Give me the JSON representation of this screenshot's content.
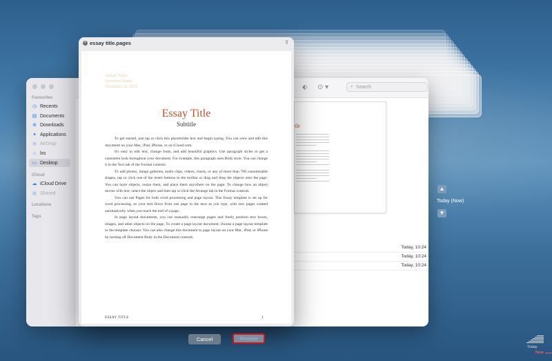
{
  "window_title": "essay title.pages",
  "document": {
    "author_lines": [
      "Author Name",
      "Instructor Name",
      "December 20, 2023"
    ],
    "title": "Essay Title",
    "subtitle": "Subtitle",
    "paragraphs": [
      "To get started, just tap or click this placeholder text and begin typing. You can view and edit this document on your Mac, iPad, iPhone, or on iCloud.com.",
      "It's easy to edit text, change fonts, and add beautiful graphics. Use paragraph styles to get a consistent look throughout your document. For example, this paragraph uses Body style. You can change it in the Text tab of the Format controls.",
      "To add photos, image galleries, audio clips, videos, charts, or any of more than 700 customisable shapes, tap or click one of the insert buttons in the toolbar or drag and drop the objects onto the page. You can layer objects, resize them, and place them anywhere on the page. To change how an object moves with text, select the object and then tap or click the Arrange tab in the Format controls.",
      "You can use Pages for both word processing and page layout. This Essay template is set up for word processing, so your text flows from one page to the next as you type, with new pages created automatically when you reach the end of a page.",
      "In page layout documents, you can manually rearrange pages and freely position text boxes, images, and other objects on the page. To create a page layout document, choose a page layout template in the template chooser. You can also change this document to page layout on your Mac, iPad, or iPhone by turning off Document Body in the Document controls."
    ],
    "footer_left": "ESSAY TITLE",
    "footer_right": "1"
  },
  "finder": {
    "sidebar": {
      "favourites_label": "Favourites",
      "icloud_label": "iCloud",
      "locations_label": "Locations",
      "tags_label": "Tags",
      "favourites": [
        {
          "label": "Recents",
          "icon": "clock-icon"
        },
        {
          "label": "Documents",
          "icon": "doc-icon"
        },
        {
          "label": "Downloads",
          "icon": "download-icon"
        },
        {
          "label": "Applications",
          "icon": "apps-icon"
        },
        {
          "label": "AirDrop",
          "icon": "airdrop-icon"
        },
        {
          "label": "lxs",
          "icon": "home-icon"
        },
        {
          "label": "Desktop",
          "icon": "desktop-icon"
        }
      ],
      "icloud": [
        {
          "label": "iCloud Drive",
          "icon": "cloud-icon"
        },
        {
          "label": "Shared",
          "icon": "shared-icon"
        }
      ]
    },
    "search_placeholder": "Search",
    "preview_title": "tle",
    "file_dates": [
      "Today, 10:24",
      "Today, 10:24",
      "Today, 10:24"
    ]
  },
  "buttons": {
    "cancel": "Cancel",
    "restore": "Restore"
  },
  "timeline": {
    "current": "Today (Now)",
    "today": "Today",
    "now": "Now"
  },
  "colors": {
    "title_accent": "#c0502b",
    "restore_highlight": "#dd1111",
    "now_marker": "#ff5a5a"
  }
}
